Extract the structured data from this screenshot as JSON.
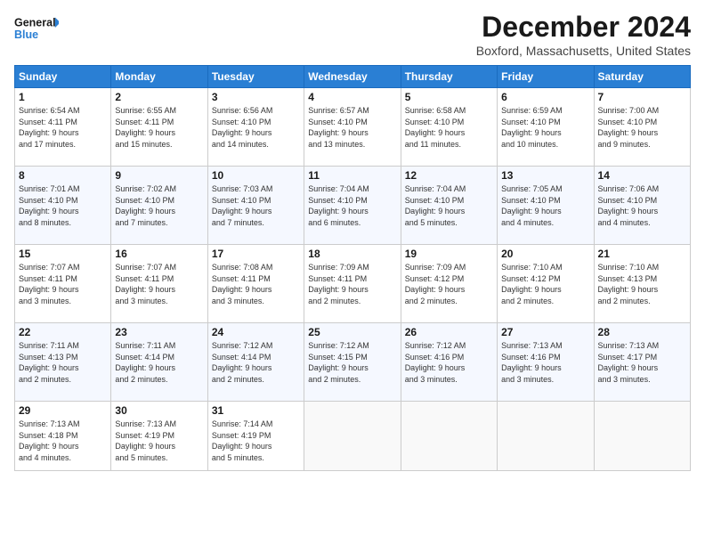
{
  "header": {
    "logo_line1": "General",
    "logo_line2": "Blue",
    "month_title": "December 2024",
    "location": "Boxford, Massachusetts, United States"
  },
  "weekdays": [
    "Sunday",
    "Monday",
    "Tuesday",
    "Wednesday",
    "Thursday",
    "Friday",
    "Saturday"
  ],
  "weeks": [
    [
      {
        "day": "1",
        "info": "Sunrise: 6:54 AM\nSunset: 4:11 PM\nDaylight: 9 hours\nand 17 minutes."
      },
      {
        "day": "2",
        "info": "Sunrise: 6:55 AM\nSunset: 4:11 PM\nDaylight: 9 hours\nand 15 minutes."
      },
      {
        "day": "3",
        "info": "Sunrise: 6:56 AM\nSunset: 4:10 PM\nDaylight: 9 hours\nand 14 minutes."
      },
      {
        "day": "4",
        "info": "Sunrise: 6:57 AM\nSunset: 4:10 PM\nDaylight: 9 hours\nand 13 minutes."
      },
      {
        "day": "5",
        "info": "Sunrise: 6:58 AM\nSunset: 4:10 PM\nDaylight: 9 hours\nand 11 minutes."
      },
      {
        "day": "6",
        "info": "Sunrise: 6:59 AM\nSunset: 4:10 PM\nDaylight: 9 hours\nand 10 minutes."
      },
      {
        "day": "7",
        "info": "Sunrise: 7:00 AM\nSunset: 4:10 PM\nDaylight: 9 hours\nand 9 minutes."
      }
    ],
    [
      {
        "day": "8",
        "info": "Sunrise: 7:01 AM\nSunset: 4:10 PM\nDaylight: 9 hours\nand 8 minutes."
      },
      {
        "day": "9",
        "info": "Sunrise: 7:02 AM\nSunset: 4:10 PM\nDaylight: 9 hours\nand 7 minutes."
      },
      {
        "day": "10",
        "info": "Sunrise: 7:03 AM\nSunset: 4:10 PM\nDaylight: 9 hours\nand 7 minutes."
      },
      {
        "day": "11",
        "info": "Sunrise: 7:04 AM\nSunset: 4:10 PM\nDaylight: 9 hours\nand 6 minutes."
      },
      {
        "day": "12",
        "info": "Sunrise: 7:04 AM\nSunset: 4:10 PM\nDaylight: 9 hours\nand 5 minutes."
      },
      {
        "day": "13",
        "info": "Sunrise: 7:05 AM\nSunset: 4:10 PM\nDaylight: 9 hours\nand 4 minutes."
      },
      {
        "day": "14",
        "info": "Sunrise: 7:06 AM\nSunset: 4:10 PM\nDaylight: 9 hours\nand 4 minutes."
      }
    ],
    [
      {
        "day": "15",
        "info": "Sunrise: 7:07 AM\nSunset: 4:11 PM\nDaylight: 9 hours\nand 3 minutes."
      },
      {
        "day": "16",
        "info": "Sunrise: 7:07 AM\nSunset: 4:11 PM\nDaylight: 9 hours\nand 3 minutes."
      },
      {
        "day": "17",
        "info": "Sunrise: 7:08 AM\nSunset: 4:11 PM\nDaylight: 9 hours\nand 3 minutes."
      },
      {
        "day": "18",
        "info": "Sunrise: 7:09 AM\nSunset: 4:11 PM\nDaylight: 9 hours\nand 2 minutes."
      },
      {
        "day": "19",
        "info": "Sunrise: 7:09 AM\nSunset: 4:12 PM\nDaylight: 9 hours\nand 2 minutes."
      },
      {
        "day": "20",
        "info": "Sunrise: 7:10 AM\nSunset: 4:12 PM\nDaylight: 9 hours\nand 2 minutes."
      },
      {
        "day": "21",
        "info": "Sunrise: 7:10 AM\nSunset: 4:13 PM\nDaylight: 9 hours\nand 2 minutes."
      }
    ],
    [
      {
        "day": "22",
        "info": "Sunrise: 7:11 AM\nSunset: 4:13 PM\nDaylight: 9 hours\nand 2 minutes."
      },
      {
        "day": "23",
        "info": "Sunrise: 7:11 AM\nSunset: 4:14 PM\nDaylight: 9 hours\nand 2 minutes."
      },
      {
        "day": "24",
        "info": "Sunrise: 7:12 AM\nSunset: 4:14 PM\nDaylight: 9 hours\nand 2 minutes."
      },
      {
        "day": "25",
        "info": "Sunrise: 7:12 AM\nSunset: 4:15 PM\nDaylight: 9 hours\nand 2 minutes."
      },
      {
        "day": "26",
        "info": "Sunrise: 7:12 AM\nSunset: 4:16 PM\nDaylight: 9 hours\nand 3 minutes."
      },
      {
        "day": "27",
        "info": "Sunrise: 7:13 AM\nSunset: 4:16 PM\nDaylight: 9 hours\nand 3 minutes."
      },
      {
        "day": "28",
        "info": "Sunrise: 7:13 AM\nSunset: 4:17 PM\nDaylight: 9 hours\nand 3 minutes."
      }
    ],
    [
      {
        "day": "29",
        "info": "Sunrise: 7:13 AM\nSunset: 4:18 PM\nDaylight: 9 hours\nand 4 minutes."
      },
      {
        "day": "30",
        "info": "Sunrise: 7:13 AM\nSunset: 4:19 PM\nDaylight: 9 hours\nand 5 minutes."
      },
      {
        "day": "31",
        "info": "Sunrise: 7:14 AM\nSunset: 4:19 PM\nDaylight: 9 hours\nand 5 minutes."
      },
      null,
      null,
      null,
      null
    ]
  ]
}
